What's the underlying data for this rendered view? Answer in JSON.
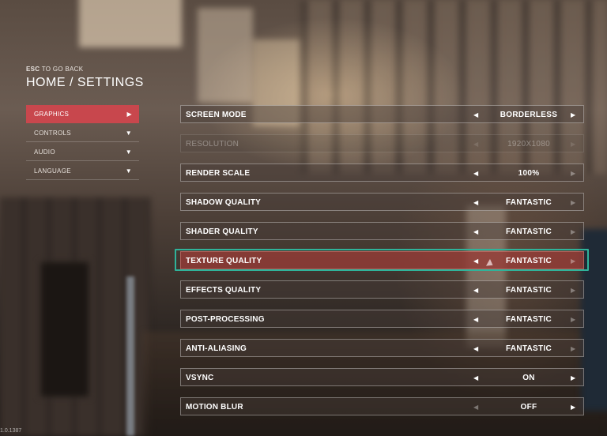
{
  "header": {
    "esc_key": "ESC",
    "esc_text": " TO GO BACK",
    "breadcrumb": "HOME / SETTINGS"
  },
  "sidebar": {
    "items": [
      {
        "label": "GRAPHICS",
        "arrow": "▶",
        "active": true
      },
      {
        "label": "CONTROLS",
        "arrow": "▼",
        "active": false
      },
      {
        "label": "AUDIO",
        "arrow": "▼",
        "active": false
      },
      {
        "label": "LANGUAGE",
        "arrow": "▼",
        "active": false
      }
    ]
  },
  "settings": {
    "arrow_left": "◀",
    "arrow_right": "▶",
    "rows": [
      {
        "label": "SCREEN MODE",
        "value": "BORDERLESS"
      },
      {
        "label": "RESOLUTION",
        "value": "1920X1080",
        "disabled": true
      },
      {
        "label": "RENDER SCALE",
        "value": "100%"
      },
      {
        "label": "SHADOW QUALITY",
        "value": "FANTASTIC"
      },
      {
        "label": "SHADER QUALITY",
        "value": "FANTASTIC"
      },
      {
        "label": "TEXTURE QUALITY",
        "value": "FANTASTIC",
        "focused": true
      },
      {
        "label": "EFFECTS QUALITY",
        "value": "FANTASTIC"
      },
      {
        "label": "POST-PROCESSING",
        "value": "FANTASTIC"
      },
      {
        "label": "ANTI-ALIASING",
        "value": "FANTASTIC"
      },
      {
        "label": "VSYNC",
        "value": "ON"
      },
      {
        "label": "MOTION BLUR",
        "value": "OFF"
      }
    ]
  },
  "version": "1.0.1387",
  "colors": {
    "accent_active": "#c8474d",
    "focus_frame": "#2fb39a",
    "focused_row": "#963c37"
  }
}
